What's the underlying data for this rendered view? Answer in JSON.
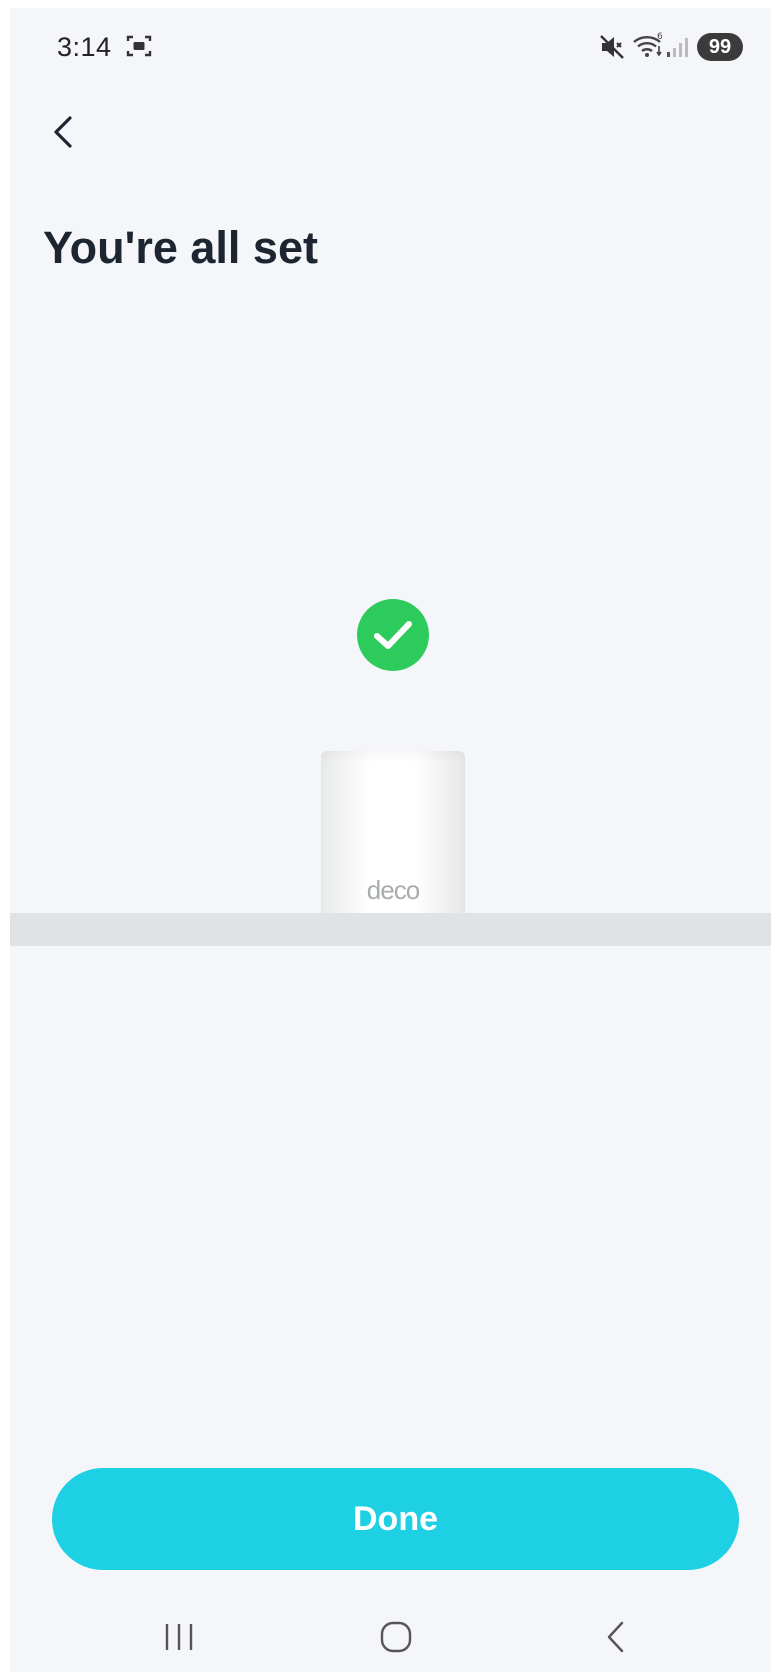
{
  "status_bar": {
    "time": "3:14",
    "battery": "99",
    "icons": [
      "screenshot-icon",
      "mute-icon",
      "wifi-icon",
      "signal-icon"
    ]
  },
  "header": {
    "back_icon": "chevron-left-icon",
    "title": "You're all set"
  },
  "illustration": {
    "status_icon": "check-circle-icon",
    "status_color": "#2dcb5b",
    "device_label": "deco"
  },
  "actions": {
    "done_label": "Done",
    "done_color": "#1ed0e3"
  },
  "nav_bar": {
    "icons": [
      "recents-icon",
      "home-icon",
      "back-icon"
    ]
  }
}
